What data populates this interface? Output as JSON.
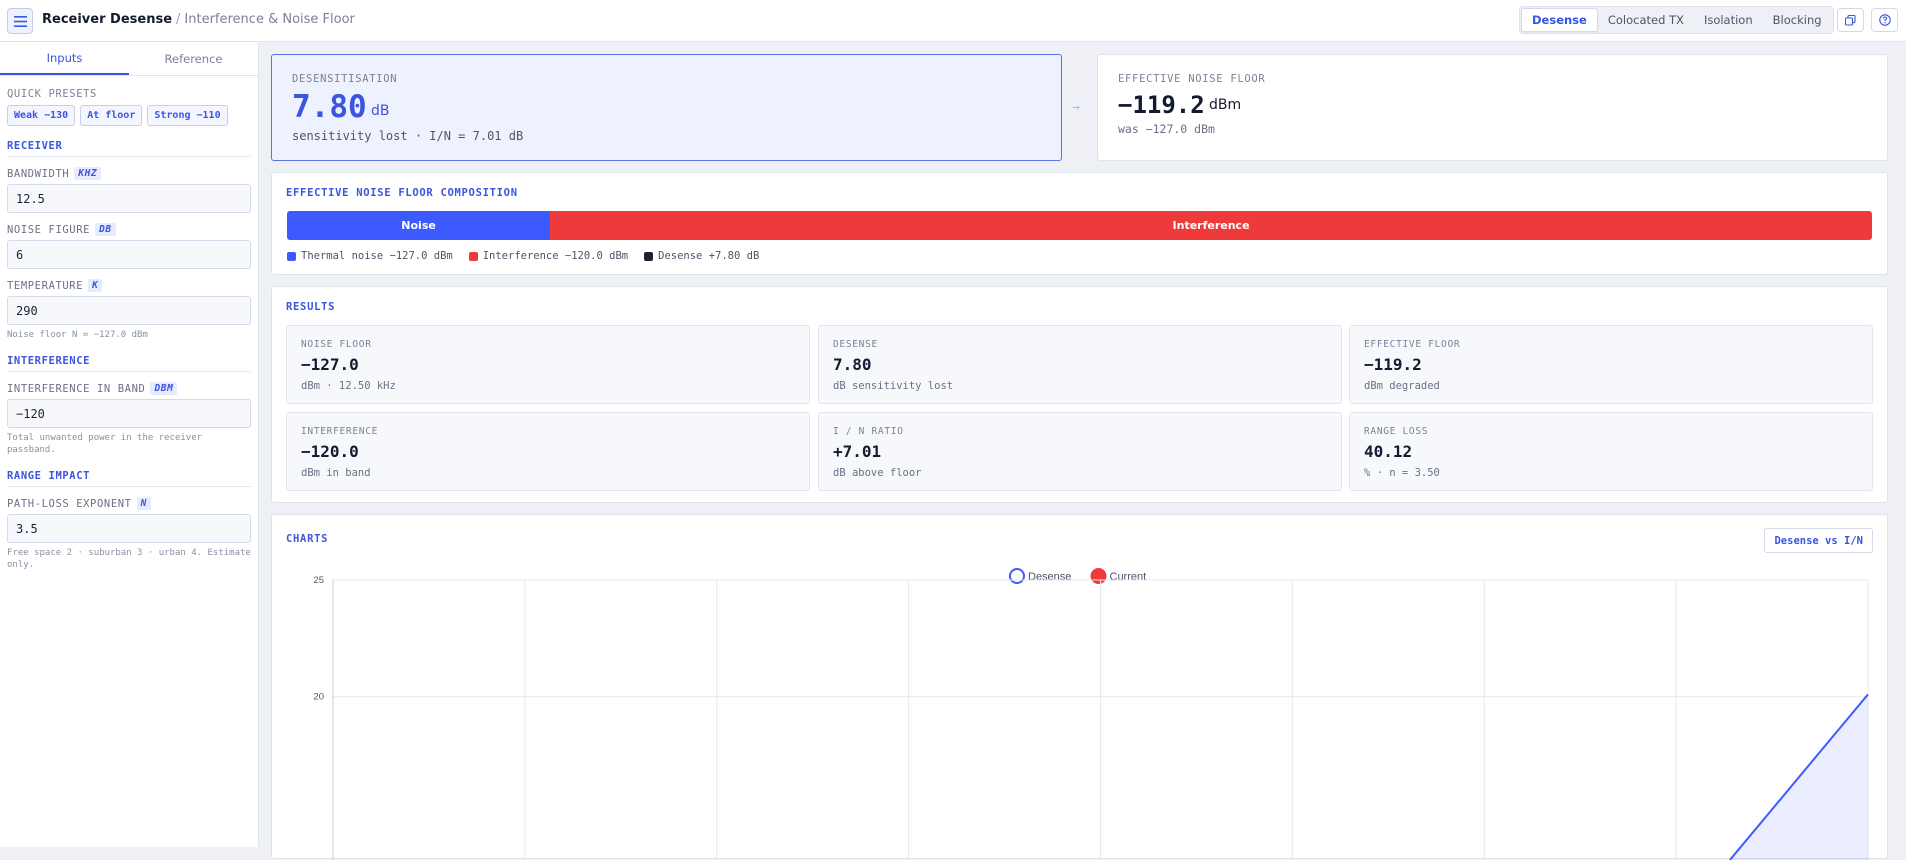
{
  "header": {
    "app_title": "Receiver Desense",
    "separator": "/",
    "subtitle": "Interference & Noise Floor",
    "menu_icon": "hamburger-menu-icon",
    "tabs": [
      {
        "label": "Desense",
        "active": true
      },
      {
        "label": "Colocated TX",
        "active": false
      },
      {
        "label": "Isolation",
        "active": false
      },
      {
        "label": "Blocking",
        "active": false
      }
    ],
    "actions": [
      {
        "icon": "copy-icon"
      },
      {
        "icon": "help-icon"
      }
    ]
  },
  "sidebar": {
    "tabs": [
      {
        "label": "Inputs",
        "active": true
      },
      {
        "label": "Reference",
        "active": false
      }
    ],
    "presets_label": "QUICK PRESETS",
    "presets": [
      "Weak −130",
      "At floor",
      "Strong −110"
    ],
    "receiver": {
      "title": "RECEIVER",
      "bandwidth": {
        "label": "BANDWIDTH",
        "unit": "KHZ",
        "value": "12.5"
      },
      "noise_figure": {
        "label": "NOISE FIGURE",
        "unit": "DB",
        "value": "6"
      },
      "temperature": {
        "label": "TEMPERATURE",
        "unit": "K",
        "value": "290"
      },
      "hint": "Noise floor N = −127.0 dBm"
    },
    "interference": {
      "title": "INTERFERENCE",
      "in_band": {
        "label": "INTERFERENCE IN BAND",
        "unit": "DBM",
        "value": "−120"
      },
      "hint": "Total unwanted power in the receiver passband."
    },
    "range": {
      "title": "RANGE IMPACT",
      "exponent": {
        "label": "PATH-LOSS EXPONENT",
        "unit": "N",
        "value": "3.5"
      },
      "hint": "Free space 2 · suburban 3 · urban 4. Estimate only."
    }
  },
  "desense": {
    "label": "DESENSITISATION",
    "value": "7.80",
    "unit": "dB",
    "note": "sensitivity lost · I/N = 7.01 dB"
  },
  "arrow": "→",
  "floor": {
    "label": "EFFECTIVE NOISE FLOOR",
    "value": "−119.2",
    "unit": "dBm",
    "note": "was −127.0 dBm"
  },
  "composition": {
    "title": "EFFECTIVE NOISE FLOOR COMPOSITION",
    "segments": [
      {
        "label": "Noise",
        "fraction": 0.166,
        "color": "#3d5afe"
      },
      {
        "label": "Interference",
        "fraction": 0.834,
        "color": "#ee3a3a"
      }
    ],
    "legend": [
      {
        "label": "Thermal noise −127.0 dBm",
        "color": "#3d5afe"
      },
      {
        "label": "Interference −120.0 dBm",
        "color": "#ee3a3a"
      },
      {
        "label": "Desense +7.80 dB",
        "color": "#1e2235"
      }
    ]
  },
  "results": {
    "title": "RESULTS",
    "metrics": [
      {
        "label": "NOISE FLOOR",
        "value": "−127.0",
        "sub": "dBm · 12.50 kHz"
      },
      {
        "label": "DESENSE",
        "value": "7.80",
        "sub": "dB sensitivity lost"
      },
      {
        "label": "EFFECTIVE FLOOR",
        "value": "−119.2",
        "sub": "dBm degraded"
      },
      {
        "label": "INTERFERENCE",
        "value": "−120.0",
        "sub": "dBm in band"
      },
      {
        "label": "I / N RATIO",
        "value": "+7.01",
        "sub": "dB above floor"
      },
      {
        "label": "RANGE LOSS",
        "value": "40.12",
        "sub": "% · n = 3.50"
      }
    ]
  },
  "charts": {
    "title": "CHARTS",
    "button_label": "Desense vs I/N"
  },
  "chart_data": {
    "type": "line",
    "series": [
      {
        "name": "Desense",
        "color": "#3d5afe"
      },
      {
        "name": "Current",
        "color": "#ee3a3a"
      }
    ],
    "y_ticks": [
      25,
      20
    ],
    "ylim": [
      13,
      25
    ],
    "x_gridlines": 8,
    "visible_line": [
      [
        0.91,
        13
      ],
      [
        1.0,
        20.1
      ]
    ],
    "grid": true,
    "legend_position": "top-center"
  }
}
